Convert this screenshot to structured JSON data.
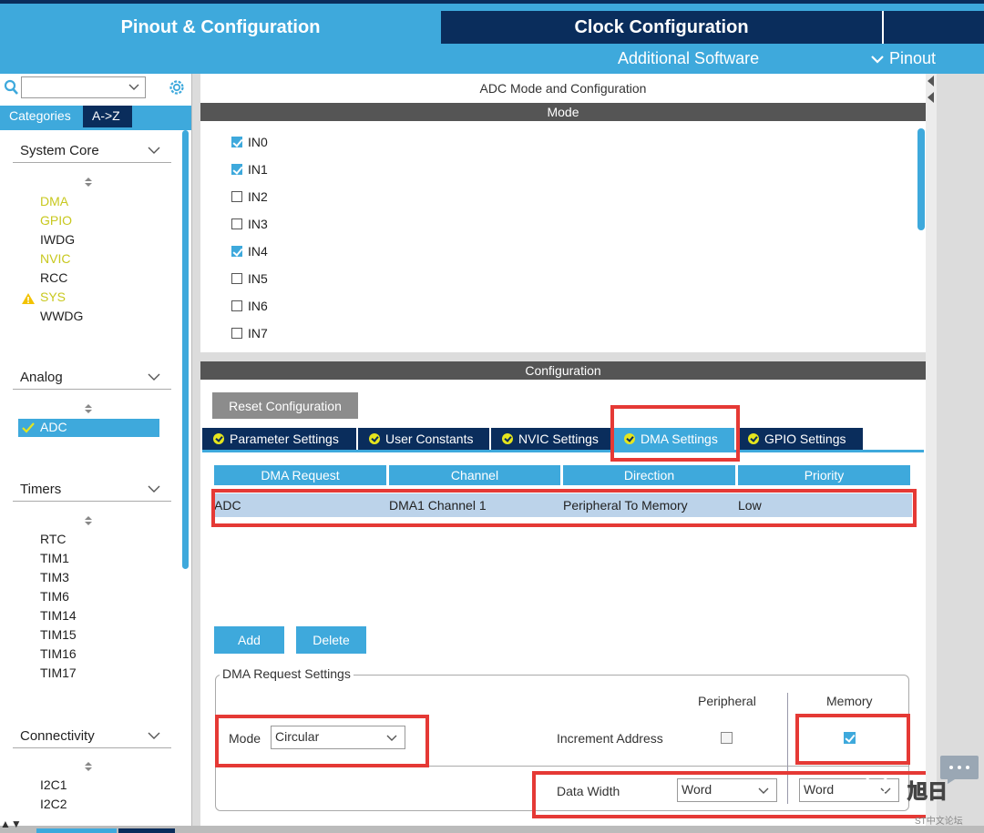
{
  "header": {
    "tab_pinout": "Pinout & Configuration",
    "tab_clock": "Clock Configuration",
    "additional_software": "Additional Software",
    "pinout_menu": "Pinout"
  },
  "sidebar": {
    "search_value": "",
    "tab_categories": "Categories",
    "tab_az": "A->Z",
    "categories": [
      {
        "name": "System Core",
        "items": [
          "DMA",
          "GPIO",
          "IWDG",
          "NVIC",
          "RCC",
          "SYS",
          "WWDG"
        ]
      },
      {
        "name": "Analog",
        "items": [
          "ADC"
        ]
      },
      {
        "name": "Timers",
        "items": [
          "RTC",
          "TIM1",
          "TIM3",
          "TIM6",
          "TIM14",
          "TIM15",
          "TIM16",
          "TIM17"
        ]
      },
      {
        "name": "Connectivity",
        "items": [
          "I2C1",
          "I2C2"
        ]
      }
    ],
    "highlight_color": "#c8c81e",
    "selected_item": "ADC"
  },
  "mode_panel": {
    "title": "ADC Mode and Configuration",
    "mode_label": "Mode",
    "inputs": [
      {
        "label": "IN0",
        "checked": true
      },
      {
        "label": "IN1",
        "checked": true
      },
      {
        "label": "IN2",
        "checked": false
      },
      {
        "label": "IN3",
        "checked": false
      },
      {
        "label": "IN4",
        "checked": true
      },
      {
        "label": "IN5",
        "checked": false
      },
      {
        "label": "IN6",
        "checked": false
      },
      {
        "label": "IN7",
        "checked": false
      }
    ]
  },
  "config_panel": {
    "title": "Configuration",
    "reset_button": "Reset Configuration",
    "tabs": [
      "Parameter Settings",
      "User Constants",
      "NVIC Settings",
      "DMA Settings",
      "GPIO Settings"
    ],
    "active_tab": "DMA Settings",
    "table": {
      "headers": [
        "DMA Request",
        "Channel",
        "Direction",
        "Priority"
      ],
      "rows": [
        [
          "ADC",
          "DMA1 Channel 1",
          "Peripheral To Memory",
          "Low"
        ]
      ]
    },
    "add_button": "Add",
    "delete_button": "Delete",
    "request_settings": {
      "legend": "DMA Request Settings",
      "peripheral_header": "Peripheral",
      "memory_header": "Memory",
      "mode_label": "Mode",
      "mode_value": "Circular",
      "increment_label": "Increment Address",
      "increment_peripheral": false,
      "increment_memory": true,
      "data_width_label": "Data Width",
      "data_width_peripheral": "Word",
      "data_width_memory": "Word"
    }
  },
  "colors": {
    "accent": "#3ea9dc",
    "navy": "#0a2d5c",
    "highlight_red": "#e53935",
    "selected_row": "#bcd3ea"
  },
  "watermark": {
    "text": "旭日",
    "sub": "ST中文论坛"
  }
}
